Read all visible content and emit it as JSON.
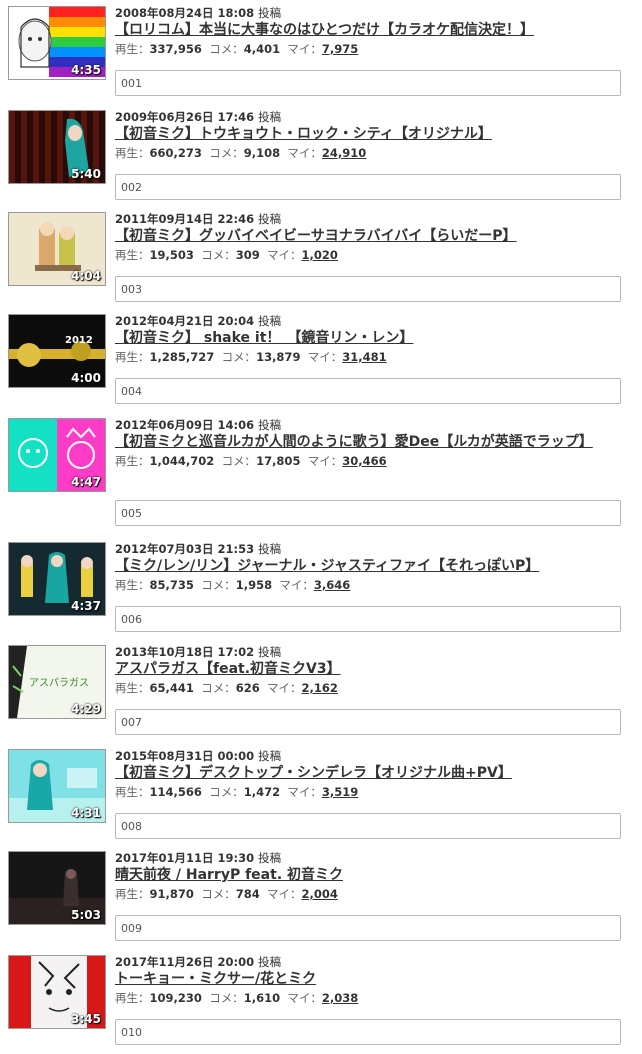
{
  "labels": {
    "posted": "投稿",
    "views": "再生：",
    "comments": "コメ：",
    "mylists": "マイ："
  },
  "videos": [
    {
      "date": "2008年08月24日 18:08",
      "title": "【ロリコム】本当に大事なのはひとつだけ【カラオケ配信決定！】",
      "views": "337,956",
      "comments": "4,401",
      "mylists": "7,975",
      "duration": "4:35",
      "memo": "001",
      "thumb_icon": "rainbow-stripes-thumbnail"
    },
    {
      "date": "2009年06月26日 17:46",
      "title": "【初音ミク】トウキョウト・ロック・シティ【オリジナル】",
      "views": "660,273",
      "comments": "9,108",
      "mylists": "24,910",
      "duration": "5:40",
      "memo": "002",
      "thumb_icon": "dark-red-curtain-thumbnail"
    },
    {
      "date": "2011年09月14日 22:46",
      "title": "【初音ミク】グッバイベイビーサヨナラバイバイ【らいだーP】",
      "views": "19,503",
      "comments": "309",
      "mylists": "1,020",
      "duration": "4:04",
      "memo": "003",
      "thumb_icon": "beige-illustration-thumbnail"
    },
    {
      "date": "2012年04月21日 20:04",
      "title": "【初音ミク】 shake it！　【鏡音リン・レン】",
      "views": "1,285,727",
      "comments": "13,879",
      "mylists": "31,481",
      "duration": "4:00",
      "memo": "004",
      "thumb_icon": "black-gold-thumbnail"
    },
    {
      "date": "2012年06月09日 14:06",
      "title": "【初音ミクと巡音ルカが人間のように歌う】愛Dee【ルカが英語でラップ】",
      "views": "1,044,702",
      "comments": "17,805",
      "mylists": "30,466",
      "duration": "4:47",
      "memo": "005",
      "thumb_icon": "teal-pink-faces-thumbnail"
    },
    {
      "date": "2012年07月03日 21:53",
      "title": "【ミク/レン/リン】ジャーナル・ジャスティファイ【それっぽいP】",
      "views": "85,735",
      "comments": "1,958",
      "mylists": "3,646",
      "duration": "4:37",
      "memo": "006",
      "thumb_icon": "three-characters-thumbnail"
    },
    {
      "date": "2013年10月18日 17:02",
      "title": "アスパラガス【feat.初音ミクV3】",
      "views": "65,441",
      "comments": "626",
      "mylists": "2,162",
      "duration": "4:29",
      "memo": "007",
      "thumb_icon": "green-text-thumbnail",
      "thumb_text": "アスパラガス"
    },
    {
      "date": "2015年08月31日 00:00",
      "title": "【初音ミク】デスクトップ・シンデレラ【オリジナル曲+PV】",
      "views": "114,566",
      "comments": "1,472",
      "mylists": "3,519",
      "duration": "4:31",
      "memo": "008",
      "thumb_icon": "cyan-character-thumbnail"
    },
    {
      "date": "2017年01月11日 19:30",
      "title": "晴天前夜 / HarryP feat. 初音ミク",
      "views": "91,870",
      "comments": "784",
      "mylists": "2,004",
      "duration": "5:03",
      "memo": "009",
      "thumb_icon": "dark-scene-thumbnail"
    },
    {
      "date": "2017年11月26日 20:00",
      "title": "トーキョー・ミクサー/花とミク",
      "views": "109,230",
      "comments": "1,610",
      "mylists": "2,038",
      "duration": "3:45",
      "memo": "010",
      "thumb_icon": "red-sketch-thumbnail"
    }
  ],
  "colors": {
    "link": "#333333",
    "memo_border": "#b9b9b9"
  }
}
